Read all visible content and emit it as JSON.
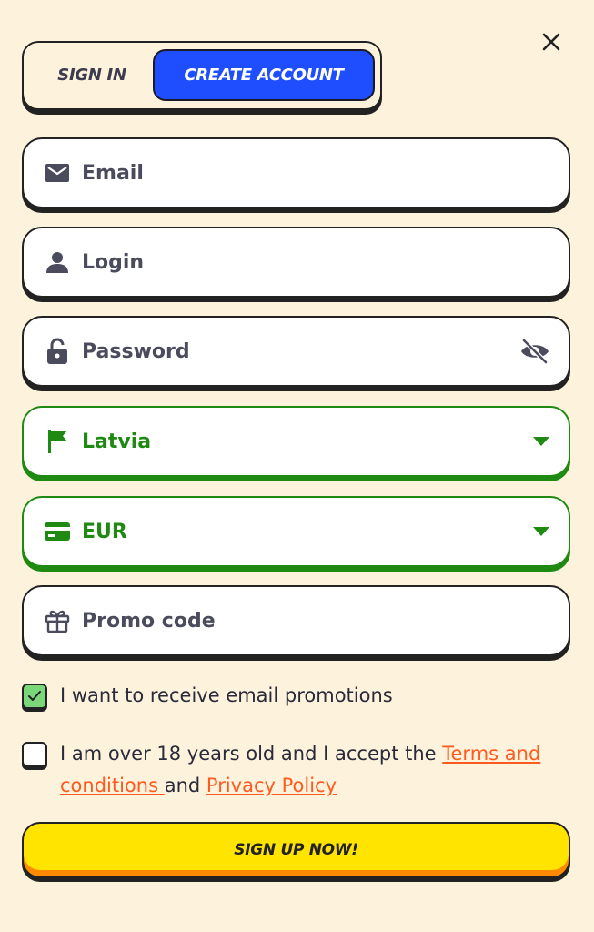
{
  "tabs": {
    "sign_in": "SIGN IN",
    "create_account": "CREATE ACCOUNT",
    "active": "create_account"
  },
  "form": {
    "email_placeholder": "Email",
    "login_placeholder": "Login",
    "password_placeholder": "Password",
    "country_value": "Latvia",
    "currency_value": "EUR",
    "promo_placeholder": "Promo code"
  },
  "checks": {
    "email_promotions": {
      "label": "I want to receive email promotions",
      "checked": true
    },
    "age_terms": {
      "checked": false,
      "text_1": "I am over 18 years old and I accept the ",
      "terms_link": "Terms and conditions ",
      "text_2": "and ",
      "privacy_link": "Privacy Policy"
    }
  },
  "submit_label": "SIGN UP NOW!",
  "icons": {
    "close": "close-icon",
    "email": "envelope-icon",
    "login": "user-icon",
    "password": "lock-icon",
    "visibility": "eye-off-icon",
    "country": "flag-icon",
    "currency": "credit-card-icon",
    "promo": "gift-icon",
    "dropdown": "chevron-down-icon"
  },
  "colors": {
    "background": "#fdf3dc",
    "accent_blue": "#1f4eff",
    "valid_green": "#1e8a12",
    "link_orange": "#ff5a1f",
    "button_yellow": "#ffe400",
    "checkbox_green": "#7ad87a"
  }
}
